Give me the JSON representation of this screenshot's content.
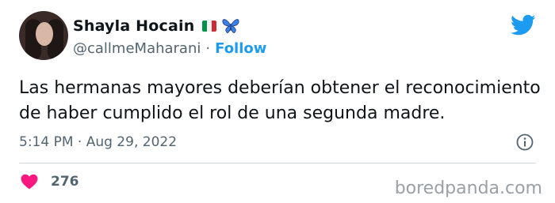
{
  "author": {
    "display_name": "Shayla Hocain",
    "handle": "@callmeMaharani",
    "flag_icon": "italy-flag-icon",
    "emoji_icon": "blue-butterfly-icon"
  },
  "follow_label": "Follow",
  "separator": "·",
  "tweet": {
    "text": "Las hermanas mayores deberían obtener el reconocimiento de haber cumplido el rol de una segunda madre.",
    "timestamp": "5:14 PM · Aug 29, 2022"
  },
  "engagement": {
    "likes": "276"
  },
  "watermark": "boredpanda.com",
  "colors": {
    "brand_blue": "#1d9bf0",
    "heart_pink": "#f91880",
    "muted_text": "#536471"
  }
}
